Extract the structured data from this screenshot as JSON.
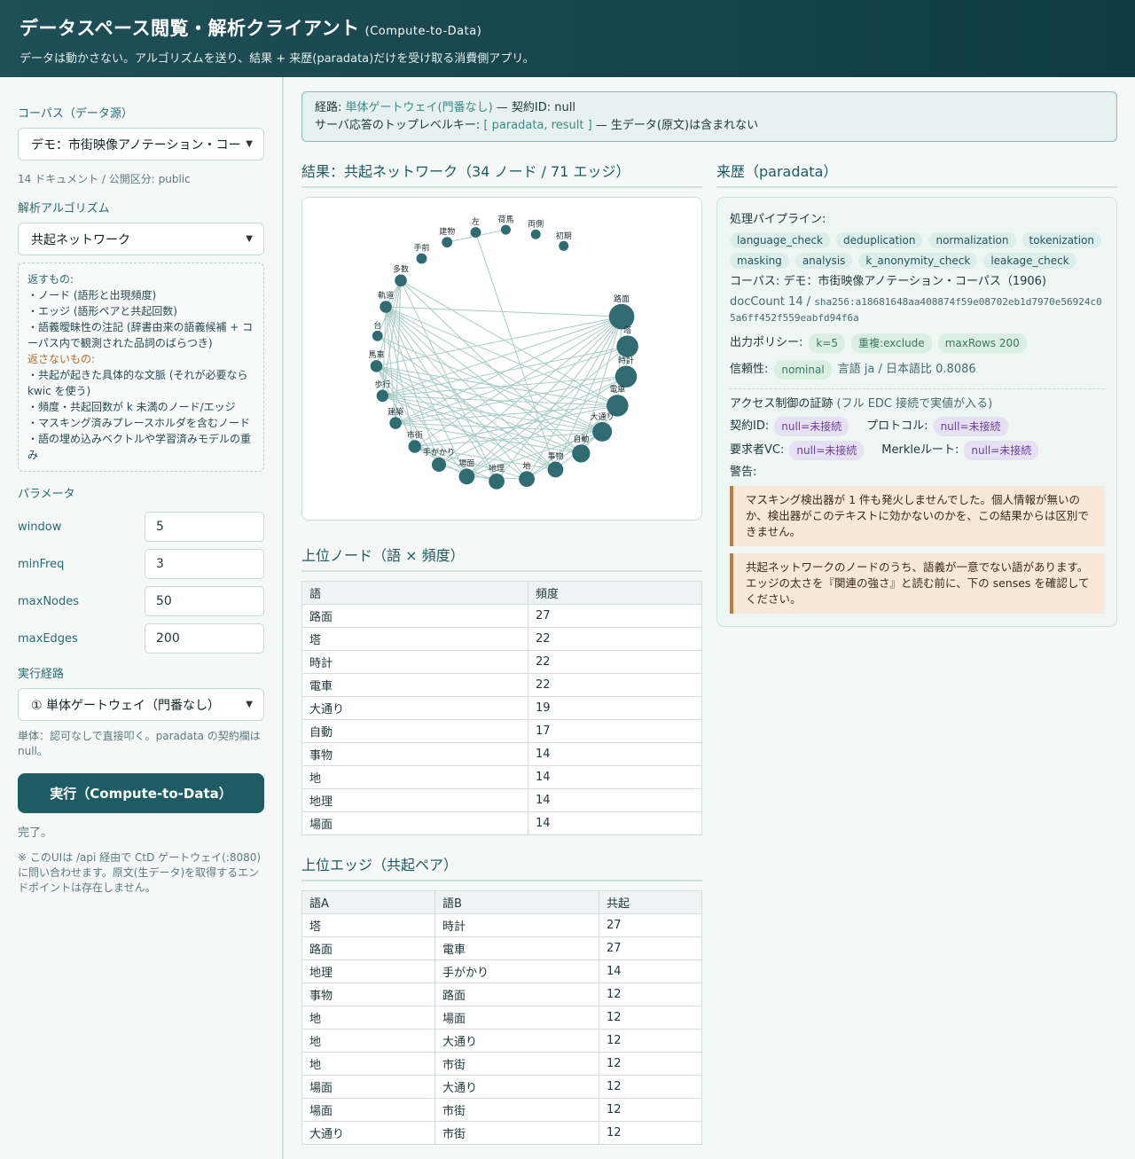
{
  "header": {
    "title": "データスペース閲覧・解析クライアント",
    "title_suffix": "(Compute-to-Data)",
    "subtitle": "データは動かさない。アルゴリズムを送り、結果 + 来歴(paradata)だけを受け取る消費側アプリ。"
  },
  "sidebar": {
    "corpus_label": "コーパス（データ源）",
    "corpus_value": "デモ：市街映像アノテーション・コー",
    "corpus_meta": "14 ドキュメント / 公開区分: public",
    "algo_label": "解析アルゴリズム",
    "algo_value": "共起ネットワーク",
    "returns_heading": "返すもの:",
    "returns": [
      "・ノード (語形と出現頻度)",
      "・エッジ (語形ペアと共起回数)",
      "・語義曖昧性の注記 (辞書由来の語義候補 + コーパス内で観測された品詞のばらつき)"
    ],
    "not_returns_heading": "返さないもの:",
    "not_returns": [
      "・共起が起きた具体的な文脈 (それが必要なら kwic を使う)",
      "・頻度・共起回数が k 未満のノード/エッジ",
      "・マスキング済みプレースホルダを含むノード",
      "・語の埋め込みベクトルや学習済みモデルの重み"
    ],
    "params_label": "パラメータ",
    "params": [
      {
        "name": "window",
        "value": "5"
      },
      {
        "name": "minFreq",
        "value": "3"
      },
      {
        "name": "maxNodes",
        "value": "50"
      },
      {
        "name": "maxEdges",
        "value": "200"
      }
    ],
    "route_label": "実行経路",
    "route_value": "① 単体ゲートウェイ（門番なし）",
    "route_note": "単体：認可なしで直接叩く。paradata の契約欄は null。",
    "run_label": "実行（Compute-to-Data）",
    "status": "完了。",
    "footnote": "※ このUIは /api 経由で CtD ゲートウェイ(:8080)に問い合わせます。原文(生データ)を取得するエンドポイントは存在しません。"
  },
  "notice": {
    "route_prefix": "経路: ",
    "route_value": "単体ゲートウェイ(門番なし)",
    "route_suffix": " — 契約ID: null",
    "keys_prefix": "サーバ応答のトップレベルキー: ",
    "keys_value": "[ paradata, result ]",
    "keys_suffix": " — 生データ(原文)は含まれない"
  },
  "result": {
    "title": "結果：共起ネットワーク（34 ノード / 71 エッジ）",
    "nodes_title": "上位ノード（語 × 頻度）",
    "nodes_headers": [
      "語",
      "頻度"
    ],
    "nodes_rows": [
      [
        "路面",
        "27"
      ],
      [
        "塔",
        "22"
      ],
      [
        "時計",
        "22"
      ],
      [
        "電車",
        "22"
      ],
      [
        "大通り",
        "19"
      ],
      [
        "自動",
        "17"
      ],
      [
        "事物",
        "14"
      ],
      [
        "地",
        "14"
      ],
      [
        "地理",
        "14"
      ],
      [
        "場面",
        "14"
      ]
    ],
    "edges_title": "上位エッジ（共起ペア）",
    "edges_headers": [
      "語A",
      "語B",
      "共起"
    ],
    "edges_rows": [
      [
        "塔",
        "時計",
        "27"
      ],
      [
        "路面",
        "電車",
        "27"
      ],
      [
        "地理",
        "手がかり",
        "14"
      ],
      [
        "事物",
        "路面",
        "12"
      ],
      [
        "地",
        "場面",
        "12"
      ],
      [
        "地",
        "大通り",
        "12"
      ],
      [
        "地",
        "市街",
        "12"
      ],
      [
        "場面",
        "大通り",
        "12"
      ],
      [
        "場面",
        "市街",
        "12"
      ],
      [
        "大通り",
        "市街",
        "12"
      ]
    ]
  },
  "graph": {
    "nodes": [
      {
        "label": "路面",
        "freq": 27
      },
      {
        "label": "塔",
        "freq": 22
      },
      {
        "label": "時計",
        "freq": 22
      },
      {
        "label": "電車",
        "freq": 22
      },
      {
        "label": "大通り",
        "freq": 19
      },
      {
        "label": "自動",
        "freq": 17
      },
      {
        "label": "事物",
        "freq": 14
      },
      {
        "label": "地",
        "freq": 14
      },
      {
        "label": "地理",
        "freq": 14
      },
      {
        "label": "場面",
        "freq": 14
      },
      {
        "label": "手がかり",
        "freq": 12
      },
      {
        "label": "市街",
        "freq": 10
      },
      {
        "label": "建築",
        "freq": 9
      },
      {
        "label": "歩行",
        "freq": 9
      },
      {
        "label": "馬車",
        "freq": 9
      },
      {
        "label": "台",
        "freq": 7
      },
      {
        "label": "軌道",
        "freq": 9
      },
      {
        "label": "多数",
        "freq": 9
      },
      {
        "label": "手前",
        "freq": 7
      },
      {
        "label": "建物",
        "freq": 7
      },
      {
        "label": "左",
        "freq": 7
      },
      {
        "label": "荷馬",
        "freq": 6
      },
      {
        "label": "両側",
        "freq": 6
      },
      {
        "label": "初期",
        "freq": 6
      }
    ],
    "edges": [
      [
        0,
        3
      ],
      [
        1,
        2
      ],
      [
        8,
        10
      ],
      [
        6,
        0
      ],
      [
        7,
        9
      ],
      [
        7,
        4
      ],
      [
        7,
        11
      ],
      [
        9,
        4
      ],
      [
        9,
        11
      ],
      [
        4,
        11
      ],
      [
        0,
        16
      ],
      [
        0,
        14
      ],
      [
        0,
        13
      ],
      [
        0,
        12
      ],
      [
        0,
        11
      ],
      [
        0,
        10
      ],
      [
        0,
        9
      ],
      [
        0,
        8
      ],
      [
        0,
        7
      ],
      [
        3,
        16
      ],
      [
        3,
        14
      ],
      [
        3,
        13
      ],
      [
        3,
        12
      ],
      [
        3,
        11
      ],
      [
        3,
        17
      ],
      [
        2,
        12
      ],
      [
        2,
        13
      ],
      [
        1,
        12
      ],
      [
        1,
        13
      ],
      [
        4,
        16
      ],
      [
        4,
        15
      ],
      [
        4,
        14
      ],
      [
        4,
        13
      ],
      [
        4,
        12
      ],
      [
        5,
        16
      ],
      [
        5,
        17
      ],
      [
        5,
        14
      ],
      [
        5,
        13
      ],
      [
        6,
        15
      ],
      [
        6,
        16
      ],
      [
        6,
        14
      ],
      [
        6,
        13
      ],
      [
        6,
        11
      ],
      [
        7,
        16
      ],
      [
        7,
        14
      ],
      [
        8,
        16
      ],
      [
        8,
        11
      ],
      [
        9,
        16
      ],
      [
        9,
        14
      ],
      [
        10,
        16
      ],
      [
        10,
        14
      ],
      [
        11,
        16
      ],
      [
        11,
        14
      ],
      [
        12,
        16
      ],
      [
        12,
        17
      ],
      [
        12,
        5
      ],
      [
        13,
        16
      ],
      [
        13,
        17
      ],
      [
        14,
        17
      ],
      [
        15,
        17
      ],
      [
        16,
        17
      ],
      [
        17,
        8
      ],
      [
        20,
        6
      ],
      [
        2,
        9
      ],
      [
        1,
        9
      ],
      [
        3,
        5
      ],
      [
        0,
        5
      ],
      [
        2,
        10
      ],
      [
        4,
        6
      ],
      [
        3,
        7
      ],
      [
        19,
        21
      ]
    ]
  },
  "provenance": {
    "title": "来歴（paradata）",
    "pipeline_label": "処理パイプライン:",
    "pipeline": [
      "language_check",
      "deduplication",
      "normalization",
      "tokenization",
      "masking",
      "analysis",
      "k_anonymity_check",
      "leakage_check"
    ],
    "corpus_line": "コーパス: デモ：市街映像アノテーション・コーパス（1906)",
    "doccount": "docCount 14 / ",
    "hash": "sha256:a18681648aa408874f59e08702eb1d7970e56924c05a6ff452f559eabfd94f6a",
    "policy_label": "出力ポリシー:",
    "policy": [
      "k=5",
      "重複:exclude",
      "maxRows 200"
    ],
    "reliability_label": "信頼性:",
    "reliability_tag": "nominal",
    "reliability_text": "言語 ja / 日本語比 0.8086",
    "access_heading": "アクセス制御の証跡",
    "access_note": "(フル EDC 接続で実値が入る)",
    "contract_label": "契約ID:",
    "contract_value": "null=未接続",
    "protocol_label": "プロトコル:",
    "protocol_value": "null=未接続",
    "vc_label": "要求者VC:",
    "vc_value": "null=未接続",
    "merkle_label": "Merkleルート:",
    "merkle_value": "null=未接続",
    "warnings_label": "警告:",
    "warnings": [
      "マスキング検出器が 1 件も発火しませんでした。個人情報が無いのか、検出器がこのテキストに効かないのかを、この結果からは区別できません。",
      "共起ネットワークのノードのうち、語義が一意でない語があります。エッジの太さを『関連の強さ』と読む前に、下の senses を確認してください。"
    ]
  }
}
